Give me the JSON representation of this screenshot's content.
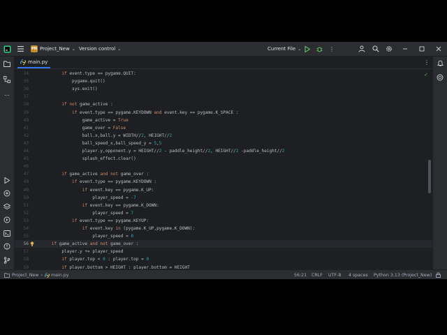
{
  "titlebar": {
    "project_badge": "PN",
    "project_name": "Project_New",
    "vcs": "Version control",
    "run_config": "Current File"
  },
  "tab": {
    "filename": "main.py"
  },
  "editor": {
    "current_line": 56,
    "lines": [
      {
        "n": "34",
        "code": "        if event.type == pygame.QUIT:"
      },
      {
        "n": "35",
        "code": "            pygame.quit()"
      },
      {
        "n": "36",
        "code": "            sys.exit()"
      },
      {
        "n": "37",
        "code": ""
      },
      {
        "n": "38",
        "code": "        if not game_active :"
      },
      {
        "n": "39",
        "code": "            if event.type == pygame.KEYDOWN and event.key == pygame.K_SPACE :"
      },
      {
        "n": "40",
        "code": "                game_active = True"
      },
      {
        "n": "41",
        "code": "                game_over = False"
      },
      {
        "n": "42",
        "code": "                ball.x,ball.y = WIDTH//2, HEIGHT//2"
      },
      {
        "n": "43",
        "code": "                ball_speed_x,ball_speed_y = 5,5"
      },
      {
        "n": "44",
        "code": "                player.y,opponent.y = HEIGHT//2 - paddle_height//2, HEIGHT//2 -paddle_height//2"
      },
      {
        "n": "45",
        "code": "                splash_effect.clear()"
      },
      {
        "n": "46",
        "code": ""
      },
      {
        "n": "47",
        "code": "        if game_active and not game_over :"
      },
      {
        "n": "48",
        "code": "            if event.type == pygame.KEYDOWN :"
      },
      {
        "n": "49",
        "code": "                if event.key == pygame.K_UP:"
      },
      {
        "n": "50",
        "code": "                    player_speed = -7"
      },
      {
        "n": "51",
        "code": "                if event.key == pygame.K_DOWN:"
      },
      {
        "n": "52",
        "code": "                    player_speed = 7"
      },
      {
        "n": "53",
        "code": "            if event.type == pygame.KEYUP:"
      },
      {
        "n": "54",
        "code": "                if event.key in (pygame.K_UP,pygame.K_DOWN):"
      },
      {
        "n": "55",
        "code": "                    player_speed = 0"
      },
      {
        "n": "56",
        "code": "    if game_active and not game_over :"
      },
      {
        "n": "57",
        "code": "        player.y += player_speed"
      },
      {
        "n": "58",
        "code": "        if player.top < 0 : player.top = 0"
      },
      {
        "n": "59",
        "code": "        if player.bottom > HEIGHT : player.bottom = HEIGHT"
      }
    ]
  },
  "statusbar": {
    "breadcrumb_project": "Project_New",
    "breadcrumb_file": "main.py",
    "position": "56:21",
    "line_ending": "CRLF",
    "encoding": "UTF-8",
    "indent": "4 spaces",
    "interpreter": "Python 3.13 (Project_New)"
  },
  "colors": {
    "keyword": "#cf8e6d",
    "number": "#2aacb8",
    "text": "#bcbec4",
    "current_line_bg": "#26282e",
    "accent": "#3574f0"
  }
}
